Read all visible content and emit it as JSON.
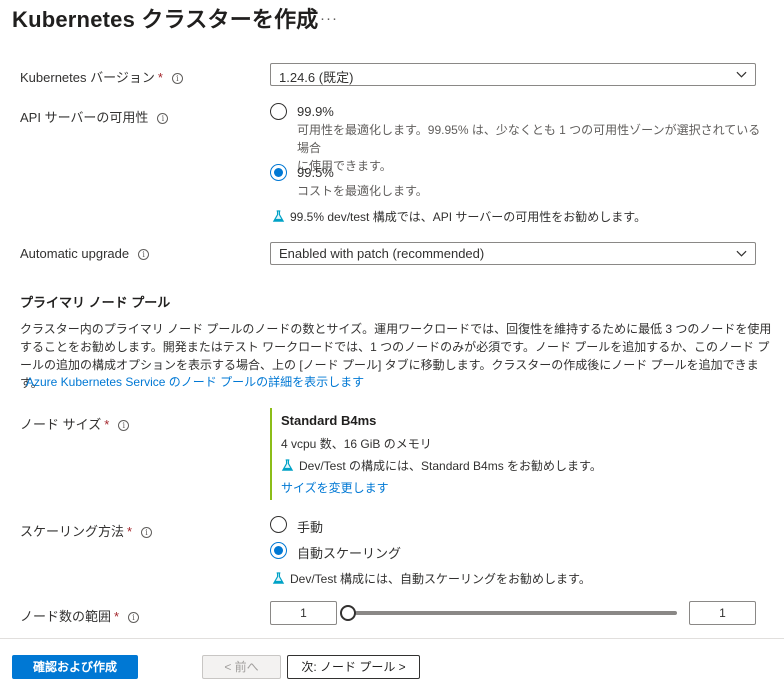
{
  "page": {
    "title": "Kubernetes クラスターを作成",
    "more_label": "···"
  },
  "k8s_version": {
    "label": "Kubernetes バージョン",
    "required_mark": "*",
    "value": "1.24.6 (既定)"
  },
  "api_availability": {
    "label": "API サーバーの可用性",
    "options": [
      {
        "label": "99.9%",
        "description": "可用性を最適化します。99.95% は、少なくとも 1 つの可用性ゾーンが選択されている場合\nに使用できます。",
        "selected": false
      },
      {
        "label": "99.5%",
        "description": "コストを最適化します。",
        "selected": true
      }
    ],
    "recommendation": "99.5% dev/test 構成では、API サーバーの可用性をお勧めします。"
  },
  "auto_upgrade": {
    "label": "Automatic upgrade",
    "value": "Enabled with patch (recommended)"
  },
  "primary_pool": {
    "heading": "プライマリ ノード プール",
    "description": "クラスター内のプライマリ ノード プールのノードの数とサイズ。運用ワークロードでは、回復性を維持するために最低 3 つのノードを使用することをお勧めします。開発またはテスト ワークロードでは、1 つのノードのみが必須です。ノード プールを追加するか、このノード プールの追加の構成オプションを表示する場合、上の [ノード プール] タブに移動します。クラスターの作成後にノード プールを追加できます。",
    "details_link": "Azure Kubernetes Service のノード プールの詳細を表示します"
  },
  "node_size": {
    "label": "ノード サイズ",
    "required_mark": "*",
    "name": "Standard B4ms",
    "spec": "4 vcpu 数、16 GiB のメモリ",
    "recommendation": "Dev/Test の構成には、Standard B4ms をお勧めします。",
    "change_link": "サイズを変更します"
  },
  "scale_method": {
    "label": "スケーリング方法",
    "required_mark": "*",
    "options": [
      {
        "label": "手動",
        "selected": false
      },
      {
        "label": "自動スケーリング",
        "selected": true
      }
    ],
    "recommendation": "Dev/Test 構成には、自動スケーリングをお勧めします。"
  },
  "node_count": {
    "label": "ノード数の範囲",
    "required_mark": "*",
    "min": "1",
    "max": "1"
  },
  "footer": {
    "review_create": "確認および作成",
    "previous": "< 前へ",
    "next": "次: ノード プール >"
  },
  "colors": {
    "accent": "#0078d4",
    "required": "#a4262c",
    "size_bar": "#8cbd18",
    "flask": "#00a2c6"
  },
  "icons": {
    "info": "info-icon",
    "chevron": "chevron-down-icon",
    "flask": "flask-icon"
  }
}
